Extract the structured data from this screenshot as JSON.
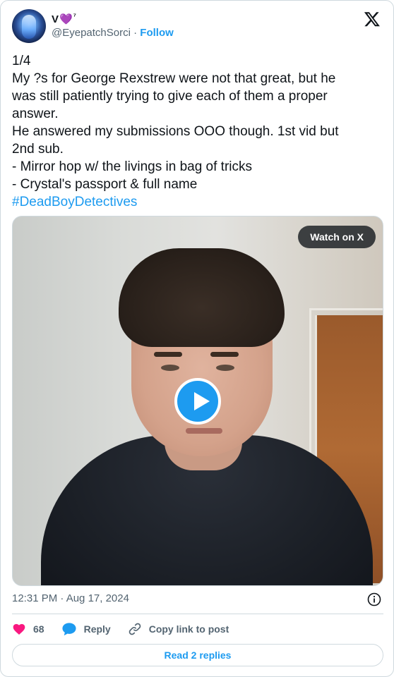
{
  "author": {
    "display_name": "V",
    "name_heart": "💜",
    "name_suffix": "⁷",
    "handle": "@EyepatchSorci",
    "separator": " · ",
    "follow_label": "Follow"
  },
  "tweet": {
    "lines": [
      "1/4",
      "My ?s for George Rexstrew were not that great, but he",
      "was still patiently trying to give each of them a proper",
      "answer.",
      "He answered my submissions OOO though. 1st vid but",
      "2nd sub.",
      "- Mirror hop w/ the livings in bag of tricks",
      "- Crystal's passport & full name"
    ],
    "hashtag": "#DeadBoyDetectives"
  },
  "media": {
    "watch_label": "Watch on X",
    "play_icon": "play-icon"
  },
  "meta": {
    "timestamp": "12:31 PM · Aug 17, 2024"
  },
  "actions": {
    "like_count": "68",
    "reply_label": "Reply",
    "copy_label": "Copy link to post"
  },
  "footer": {
    "read_replies_label": "Read 2 replies"
  },
  "colors": {
    "accent": "#1d9bf0",
    "like": "#f91880",
    "text": "#0f1419",
    "muted": "#536471",
    "border": "#cfd9de"
  }
}
